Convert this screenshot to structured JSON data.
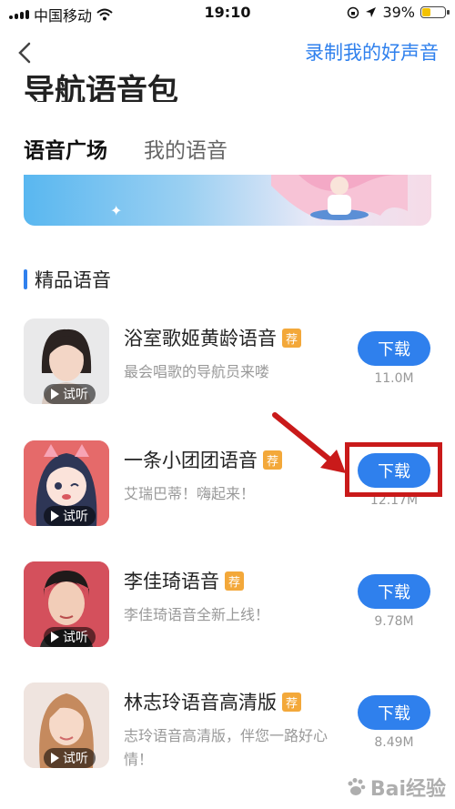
{
  "status_bar": {
    "carrier": "中国移动",
    "time": "19:10",
    "battery": "39%",
    "battery_level": 0.39
  },
  "nav": {
    "record_label": "录制我的好声音"
  },
  "page": {
    "title": "导航语音包"
  },
  "tabs": [
    {
      "label": "语音广场",
      "active": true
    },
    {
      "label": "我的语音",
      "active": false
    }
  ],
  "section": {
    "title": "精品语音"
  },
  "voices": [
    {
      "name": "浴室歌姬黄龄语音",
      "badge": "荐",
      "desc": "最会唱歌的导航员来喽",
      "listen": "试听",
      "download": "下载",
      "size": "11.0M"
    },
    {
      "name": "一条小团团语音",
      "badge": "荐",
      "desc": "艾瑞巴蒂！嗨起来！",
      "listen": "试听",
      "download": "下载",
      "size": "12.17M"
    },
    {
      "name": "李佳琦语音",
      "badge": "荐",
      "desc": "李佳琦语音全新上线！",
      "listen": "试听",
      "download": "下载",
      "size": "9.78M"
    },
    {
      "name": "林志玲语音高清版",
      "badge": "荐",
      "desc": "志玲语音高清版，伴您一路好心情！",
      "listen": "试听",
      "download": "下载",
      "size": "8.49M"
    }
  ],
  "watermark": {
    "text": "Bai经验"
  },
  "colors": {
    "accent": "#2f80ed",
    "badge": "#f3a83a",
    "annotation": "#c91a1a"
  }
}
